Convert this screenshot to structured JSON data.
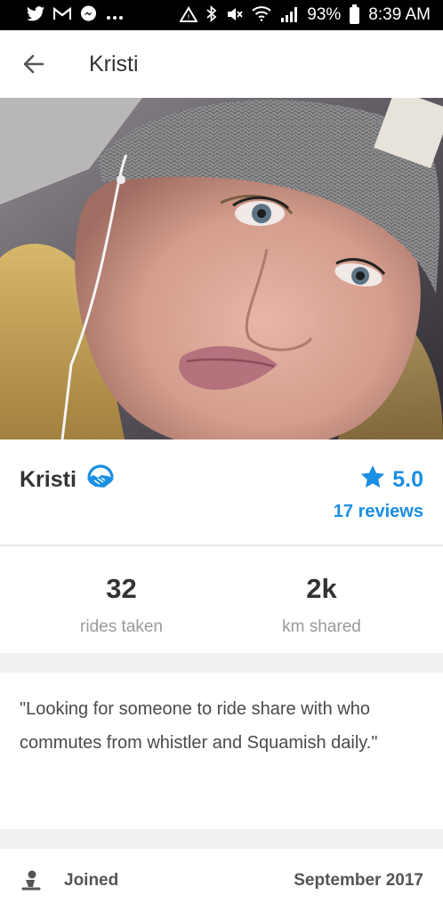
{
  "status_bar": {
    "icons_left": [
      "twitter-icon",
      "gmail-icon",
      "messenger-icon",
      "more-icon"
    ],
    "icons_right": [
      "alarm-icon",
      "bluetooth-icon",
      "mute-icon",
      "wifi-icon",
      "signal-icon"
    ],
    "battery": "93%",
    "time": "8:39 AM"
  },
  "app_bar": {
    "title": "Kristi"
  },
  "profile": {
    "name": "Kristi",
    "rating": "5.0",
    "reviews": "17 reviews",
    "accent_color": "#1a8fe3"
  },
  "stats": [
    {
      "value": "32",
      "label": "rides taken"
    },
    {
      "value": "2k",
      "label": "km shared"
    }
  ],
  "bio": {
    "text": "\"Looking for someone to ride share with who commutes from whistler and Squamish daily.\""
  },
  "joined": {
    "label": "Joined",
    "value": "September 2017"
  }
}
